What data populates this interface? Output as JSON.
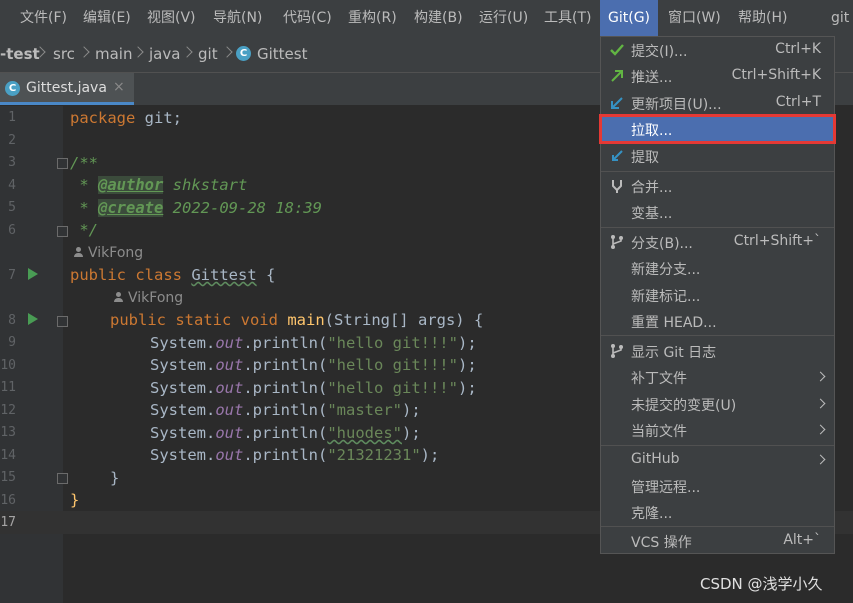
{
  "menubar": {
    "items": [
      "文件(F)",
      "编辑(E)",
      "视图(V)",
      "导航(N)",
      "代码(C)",
      "重构(R)",
      "构建(B)",
      "运行(U)",
      "工具(T)",
      "Git(G)",
      "窗口(W)",
      "帮助(H)"
    ],
    "overflow": "git"
  },
  "breadcrumb": {
    "items": [
      "-test",
      "src",
      "main",
      "java",
      "git",
      "Gittest"
    ]
  },
  "tab": {
    "label": "Gittest.java",
    "close": "×",
    "file_icon": "C"
  },
  "editor": {
    "line_numbers": [
      "1",
      "2",
      "3",
      "4",
      "5",
      "6",
      "7",
      "8",
      "9",
      "10",
      "11",
      "12",
      "13",
      "14",
      "15",
      "16",
      "17"
    ],
    "lines": {
      "l1_kw": "package",
      "l1_rest": " git;",
      "l3": "/**",
      "l4_pre": " * ",
      "l4_tag": "@author",
      "l4_val": " shkstart",
      "l5_pre": " * ",
      "l5_tag": "@create",
      "l5_val": " 2022-09-28 18:39",
      "l6": " */",
      "hint1": "VikFong",
      "l7_kw": "public class",
      "l7_name": "Gittest",
      "l7_rest": " {",
      "hint2": "VikFong",
      "l8_kw": "public static void",
      "l8_fn": "main",
      "l8_rest": "(String[] args) {",
      "println_pre": "System.",
      "println_out": "out",
      "println_mid": ".println(",
      "println_end": ");",
      "s9": "\"hello git!!!\"",
      "s10": "\"hello git!!!\"",
      "s11": "\"hello git!!!\"",
      "s12": "\"master\"",
      "s13": "\"huodes\"",
      "s14": "\"21321231\"",
      "l15": "}",
      "l16": "}"
    }
  },
  "git_menu": {
    "commit": {
      "label": "提交(I)...",
      "shortcut": "Ctrl+K"
    },
    "push": {
      "label": "推送...",
      "shortcut": "Ctrl+Shift+K"
    },
    "update": {
      "label": "更新项目(U)...",
      "shortcut": "Ctrl+T"
    },
    "pull": {
      "label": "拉取..."
    },
    "fetch": {
      "label": "提取"
    },
    "merge": {
      "label": "合并..."
    },
    "rebase": {
      "label": "变基..."
    },
    "branches": {
      "label": "分支(B)...",
      "shortcut": "Ctrl+Shift+`"
    },
    "new_branch": {
      "label": "新建分支..."
    },
    "new_tag": {
      "label": "新建标记..."
    },
    "reset_head": {
      "label": "重置 HEAD..."
    },
    "show_log": {
      "label": "显示 Git 日志"
    },
    "patch": {
      "label": "补丁文件"
    },
    "uncommitted": {
      "label": "未提交的变更(U)"
    },
    "current_file": {
      "label": "当前文件"
    },
    "github": {
      "label": "GitHub"
    },
    "remotes": {
      "label": "管理远程..."
    },
    "clone": {
      "label": "克隆..."
    },
    "vcs_ops": {
      "label": "VCS 操作",
      "shortcut": "Alt+`"
    }
  },
  "watermark": "CSDN @浅学小久",
  "colors": {
    "accent": "#4b6eaf",
    "highlight_border": "#e53935",
    "run_icon": "#499c54"
  }
}
